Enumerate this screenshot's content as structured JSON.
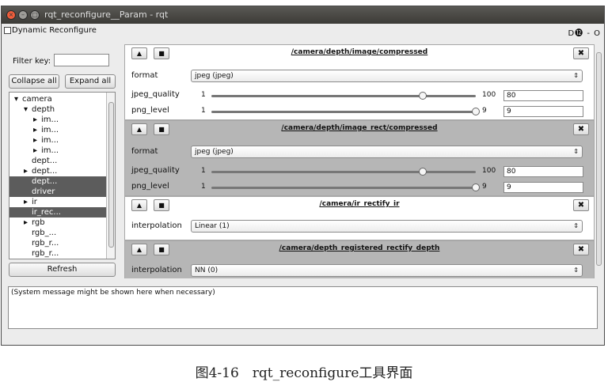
{
  "window": {
    "title": "rqt_reconfigure__Param - rqt"
  },
  "dock": {
    "title": "Dynamic Reconfigure",
    "controls": "D⓬ - O"
  },
  "left": {
    "filter_label": "Filter key:",
    "filter_value": "",
    "collapse_label": "Collapse all",
    "expand_label": "Expand all",
    "refresh_label": "Refresh",
    "tree": [
      {
        "indent": 0,
        "arrow": "▾",
        "label": "camera",
        "selected": false
      },
      {
        "indent": 1,
        "arrow": "▾",
        "label": "depth",
        "selected": false
      },
      {
        "indent": 2,
        "arrow": "▸",
        "label": "im...",
        "selected": false
      },
      {
        "indent": 2,
        "arrow": "▸",
        "label": "im...",
        "selected": false
      },
      {
        "indent": 2,
        "arrow": "▸",
        "label": "im...",
        "selected": false
      },
      {
        "indent": 2,
        "arrow": "▸",
        "label": "im...",
        "selected": false
      },
      {
        "indent": 1,
        "arrow": "",
        "label": "dept...",
        "selected": false
      },
      {
        "indent": 1,
        "arrow": "▸",
        "label": "dept...",
        "selected": false
      },
      {
        "indent": 1,
        "arrow": "",
        "label": "dept...",
        "selected": true
      },
      {
        "indent": 1,
        "arrow": "",
        "label": "driver",
        "selected": true
      },
      {
        "indent": 1,
        "arrow": "▸",
        "label": "ir",
        "selected": false
      },
      {
        "indent": 1,
        "arrow": "",
        "label": "ir_rec...",
        "selected": true
      },
      {
        "indent": 1,
        "arrow": "▸",
        "label": "rgb",
        "selected": false
      },
      {
        "indent": 1,
        "arrow": "",
        "label": "rgb_...",
        "selected": false
      },
      {
        "indent": 1,
        "arrow": "",
        "label": "rgb_r...",
        "selected": false
      },
      {
        "indent": 1,
        "arrow": "",
        "label": "rgb_r...",
        "selected": false
      }
    ]
  },
  "panels": [
    {
      "title": "/camera/depth/image/compressed",
      "style": "white",
      "format_label": "format",
      "format_value": "jpeg (jpeg)",
      "jpeg_label": "jpeg_quality",
      "jpeg_min": "1",
      "jpeg_max": "100",
      "jpeg_value": "80",
      "jpeg_fraction": 0.8,
      "png_label": "png_level",
      "png_min": "1",
      "png_max": "9",
      "png_value": "9",
      "png_fraction": 1.0
    },
    {
      "title": "/camera/depth/image_rect/compressed",
      "style": "gray",
      "format_label": "format",
      "format_value": "jpeg (jpeg)",
      "jpeg_label": "jpeg_quality",
      "jpeg_min": "1",
      "jpeg_max": "100",
      "jpeg_value": "80",
      "jpeg_fraction": 0.8,
      "png_label": "png_level",
      "png_min": "1",
      "png_max": "9",
      "png_value": "9",
      "png_fraction": 1.0
    },
    {
      "title": "/camera/ir_rectify_ir",
      "style": "white",
      "param_label": "interpolation",
      "param_value": "Linear (1)"
    },
    {
      "title": "/camera/depth_registered_rectify_depth",
      "style": "gray",
      "param_label": "interpolation",
      "param_value": "NN (0)"
    }
  ],
  "message": "(System message might be shown here when necessary)",
  "caption": "图4-16　rqt_reconfigure工具界面"
}
